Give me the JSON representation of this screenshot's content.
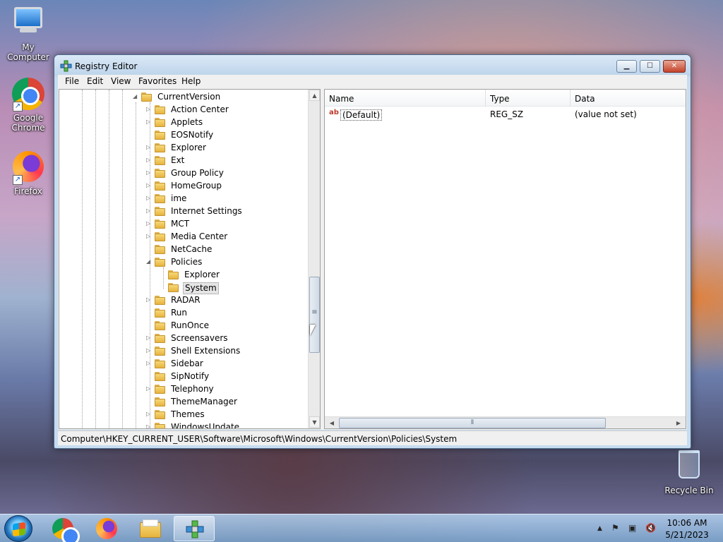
{
  "desktop": {
    "icons": [
      {
        "label": "My Computer",
        "icon": "computer-icon"
      },
      {
        "label": "Google Chrome",
        "icon": "chrome-icon"
      },
      {
        "label": "Firefox",
        "icon": "firefox-icon"
      },
      {
        "label": "Recycle Bin",
        "icon": "recycle-bin-icon"
      }
    ]
  },
  "window": {
    "title": "Registry Editor",
    "icon": "regedit-icon",
    "controls": {
      "minimize": "▁",
      "maximize": "☐",
      "close": "✕"
    },
    "menu": [
      "File",
      "Edit",
      "View",
      "Favorites",
      "Help"
    ],
    "tree": {
      "items": [
        {
          "label": "CurrentVersion",
          "toggle": "◢",
          "level": 0
        },
        {
          "label": "Action Center",
          "toggle": "▷",
          "level": 1
        },
        {
          "label": "Applets",
          "toggle": "▷",
          "level": 1
        },
        {
          "label": "EOSNotify",
          "toggle": "",
          "level": 1
        },
        {
          "label": "Explorer",
          "toggle": "▷",
          "level": 1
        },
        {
          "label": "Ext",
          "toggle": "▷",
          "level": 1
        },
        {
          "label": "Group Policy",
          "toggle": "▷",
          "level": 1
        },
        {
          "label": "HomeGroup",
          "toggle": "▷",
          "level": 1
        },
        {
          "label": "ime",
          "toggle": "▷",
          "level": 1
        },
        {
          "label": "Internet Settings",
          "toggle": "▷",
          "level": 1
        },
        {
          "label": "MCT",
          "toggle": "▷",
          "level": 1
        },
        {
          "label": "Media Center",
          "toggle": "▷",
          "level": 1
        },
        {
          "label": "NetCache",
          "toggle": "",
          "level": 1
        },
        {
          "label": "Policies",
          "toggle": "◢",
          "level": 1
        },
        {
          "label": "Explorer",
          "toggle": "",
          "level": 2
        },
        {
          "label": "System",
          "toggle": "",
          "level": 2,
          "selected": true
        },
        {
          "label": "RADAR",
          "toggle": "▷",
          "level": 1
        },
        {
          "label": "Run",
          "toggle": "",
          "level": 1
        },
        {
          "label": "RunOnce",
          "toggle": "",
          "level": 1
        },
        {
          "label": "Screensavers",
          "toggle": "▷",
          "level": 1
        },
        {
          "label": "Shell Extensions",
          "toggle": "▷",
          "level": 1
        },
        {
          "label": "Sidebar",
          "toggle": "▷",
          "level": 1
        },
        {
          "label": "SipNotify",
          "toggle": "",
          "level": 1
        },
        {
          "label": "Telephony",
          "toggle": "▷",
          "level": 1
        },
        {
          "label": "ThemeManager",
          "toggle": "",
          "level": 1
        },
        {
          "label": "Themes",
          "toggle": "▷",
          "level": 1
        },
        {
          "label": "WindowsUpdate",
          "toggle": "▷",
          "level": 1
        }
      ],
      "scroll_position_fraction": 0.55
    },
    "list": {
      "columns": [
        "Name",
        "Type",
        "Data"
      ],
      "rows": [
        {
          "name": "(Default)",
          "type": "REG_SZ",
          "data": "(value not set)",
          "icon": "string-value-icon"
        }
      ]
    },
    "status": "Computer\\HKEY_CURRENT_USER\\Software\\Microsoft\\Windows\\CurrentVersion\\Policies\\System"
  },
  "taskbar": {
    "apps": [
      {
        "name": "chrome-icon",
        "active": false
      },
      {
        "name": "firefox-icon",
        "active": false
      },
      {
        "name": "file-explorer-icon",
        "active": false
      },
      {
        "name": "regedit-icon",
        "active": true
      }
    ],
    "tray": {
      "show_hidden": "▲",
      "icons": [
        "action-center-flag-icon",
        "network-icon",
        "volume-muted-icon"
      ]
    },
    "clock": {
      "time": "10:06 AM",
      "date": "5/21/2023"
    }
  },
  "colors": {
    "window_frame": "#c7dcf0",
    "close_button": "#c3432a",
    "folder": "#e7b33e",
    "selection": "#e5e5e5"
  }
}
